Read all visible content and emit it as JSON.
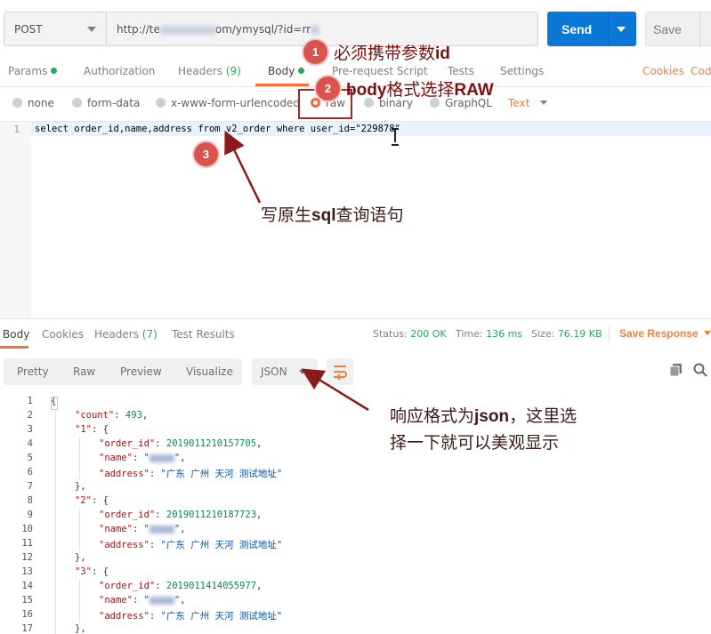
{
  "request": {
    "method": "POST",
    "url_prefix": "http://te",
    "url_suffix": "om/ymysql/?id=rr",
    "send_label": "Send",
    "save_label": "Save"
  },
  "request_tabs": [
    {
      "label": "Params"
    },
    {
      "label": "Authorization"
    },
    {
      "label": "Headers",
      "count": "(9)"
    },
    {
      "label": "Body"
    },
    {
      "label": "Pre-request Script"
    },
    {
      "label": "Tests"
    },
    {
      "label": "Settings"
    }
  ],
  "request_links": {
    "cookies": "Cookies",
    "code": "Cod"
  },
  "body_types": [
    "none",
    "form-data",
    "x-www-form-urlencoded",
    "raw",
    "binary",
    "GraphQL"
  ],
  "body_format": "Text",
  "editor": {
    "line_number": "1",
    "code": "select order_id,name,address from v2_order where user_id=\"229878\""
  },
  "response_tabs": [
    {
      "label": "Body"
    },
    {
      "label": "Cookies"
    },
    {
      "label": "Headers",
      "count": "(7)"
    },
    {
      "label": "Test Results"
    }
  ],
  "response_meta": {
    "status_label": "Status:",
    "status_value": "200 OK",
    "time_label": "Time:",
    "time_value": "136 ms",
    "size_label": "Size:",
    "size_value": "76.19 KB",
    "save_response": "Save Response"
  },
  "view_modes": [
    "Pretty",
    "Raw",
    "Preview",
    "Visualize"
  ],
  "response_format": "JSON",
  "response_lines": [
    {
      "n": "1",
      "indent": 0,
      "text": "{"
    },
    {
      "n": "2",
      "indent": 1,
      "key": "\"count\"",
      "value": "493",
      "type": "num",
      "tail": ","
    },
    {
      "n": "3",
      "indent": 1,
      "key": "\"1\"",
      "value": "{",
      "type": "plain"
    },
    {
      "n": "4",
      "indent": 2,
      "key": "\"order_id\"",
      "value": "2019011210157705",
      "type": "num",
      "tail": ","
    },
    {
      "n": "5",
      "indent": 2,
      "key": "\"name\"",
      "value": "",
      "type": "blur",
      "tail": ","
    },
    {
      "n": "6",
      "indent": 2,
      "key": "\"address\"",
      "value": "\"广东 广州 天河 测试地址\"",
      "type": "str"
    },
    {
      "n": "7",
      "indent": 1,
      "text": "},"
    },
    {
      "n": "8",
      "indent": 1,
      "key": "\"2\"",
      "value": "{",
      "type": "plain"
    },
    {
      "n": "9",
      "indent": 2,
      "key": "\"order_id\"",
      "value": "2019011210187723",
      "type": "num",
      "tail": ","
    },
    {
      "n": "10",
      "indent": 2,
      "key": "\"name\"",
      "value": "",
      "type": "blur",
      "tail": ","
    },
    {
      "n": "11",
      "indent": 2,
      "key": "\"address\"",
      "value": "\"广东 广州 天河 测试地址\"",
      "type": "str"
    },
    {
      "n": "12",
      "indent": 1,
      "text": "},"
    },
    {
      "n": "13",
      "indent": 1,
      "key": "\"3\"",
      "value": "{",
      "type": "plain"
    },
    {
      "n": "14",
      "indent": 2,
      "key": "\"order_id\"",
      "value": "2019011414055977",
      "type": "num",
      "tail": ","
    },
    {
      "n": "15",
      "indent": 2,
      "key": "\"name\"",
      "value": "",
      "type": "blur",
      "tail": ","
    },
    {
      "n": "16",
      "indent": 2,
      "key": "\"address\"",
      "value": "\"广东 广州 天河 测试地址\"",
      "type": "str"
    },
    {
      "n": "17",
      "indent": 1,
      "text": "},"
    }
  ],
  "annotations": {
    "a1_num": "1",
    "a1_pre": "必须携带参数",
    "a1_bold": "id",
    "a2_num": "2",
    "a2_bold1": "body",
    "a2_mid": "格式选择",
    "a2_bold2": "RAW",
    "a3_num": "3",
    "a3_pre": "写原生",
    "a3_bold": "sql",
    "a3_post": "查询语句",
    "a4_line1_pre": "响应格式为",
    "a4_line1_bold": "json",
    "a4_line1_post": "，这里选",
    "a4_line2": "择一下就可以美观显示"
  },
  "colors": {
    "accent": "#ff6c37",
    "send": "#0b78d7",
    "status_ok": "#26a95b",
    "annotation": "#9b2b2b"
  }
}
